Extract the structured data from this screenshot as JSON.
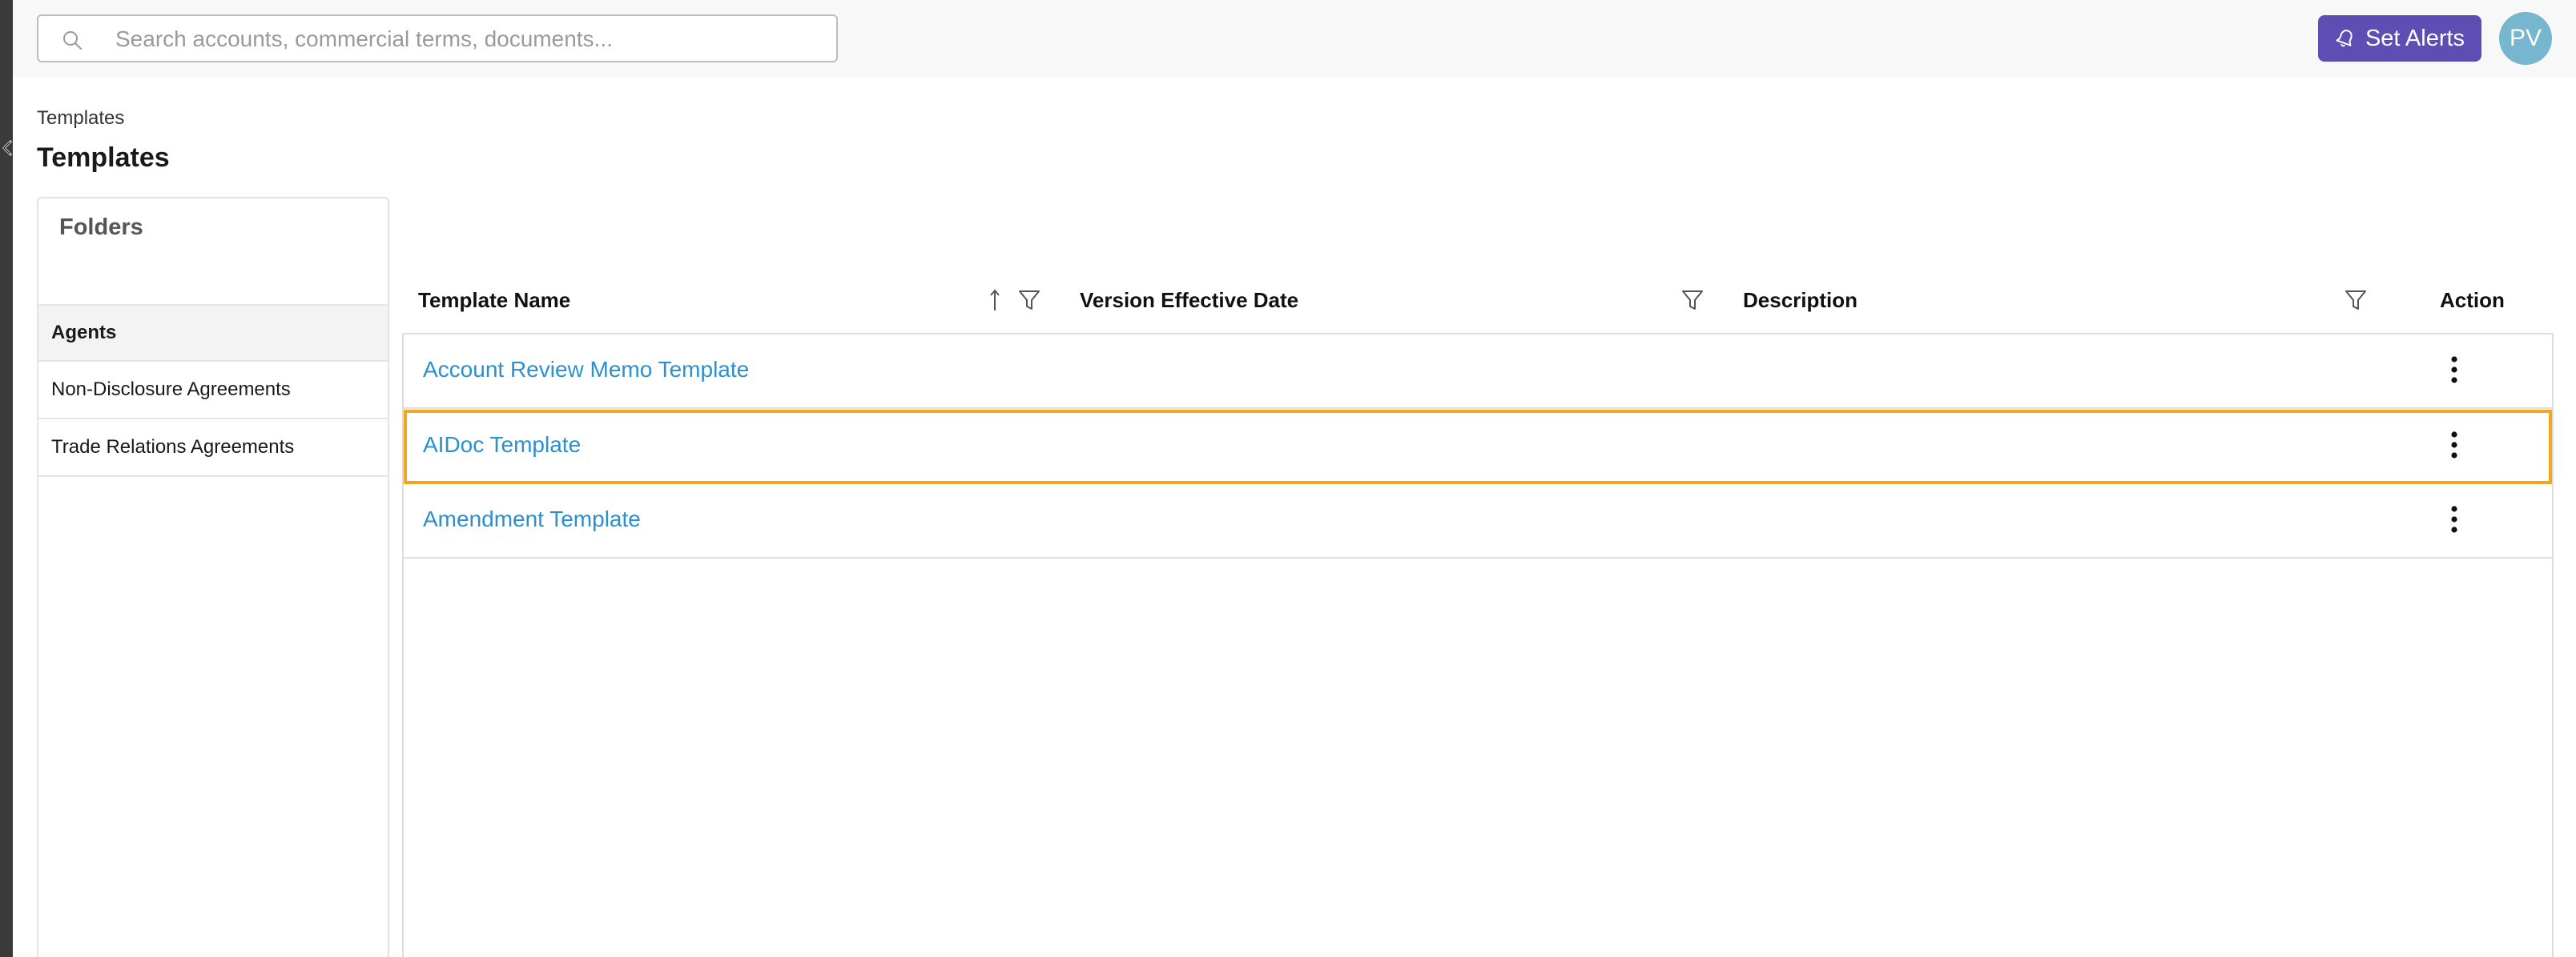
{
  "search": {
    "placeholder": "Search accounts, commercial terms, documents..."
  },
  "header": {
    "alerts_label": "Set Alerts",
    "avatar_initials": "PV"
  },
  "page": {
    "breadcrumb": "Templates",
    "title": "Templates"
  },
  "folders": {
    "title": "Folders",
    "items": [
      {
        "label": "Agents",
        "active": true
      },
      {
        "label": "Non-Disclosure Agreements",
        "active": false
      },
      {
        "label": "Trade Relations Agreements",
        "active": false
      }
    ]
  },
  "table": {
    "columns": [
      {
        "label": "Template Name",
        "sort": "ascending",
        "filter": true
      },
      {
        "label": "Version Effective Date",
        "filter": true
      },
      {
        "label": "Description",
        "filter": true
      },
      {
        "label": "Action"
      }
    ],
    "rows": [
      {
        "name": "Account Review Memo Template",
        "selected": false
      },
      {
        "name": "AIDoc Template",
        "selected": true
      },
      {
        "name": "Amendment Template",
        "selected": false
      }
    ]
  },
  "colors": {
    "accent": "#5e4db2",
    "avatar": "#76b6cf",
    "link": "#2b8fd0",
    "selection": "#f3a51e",
    "rail": "#3a3a3a"
  },
  "icons": {
    "search": "search-icon",
    "collapse": "chevron-left-icon",
    "alerts": "bell-icon",
    "sort": "arrow-up-icon",
    "filter": "filter-icon",
    "action": "more-vertical-icon"
  }
}
